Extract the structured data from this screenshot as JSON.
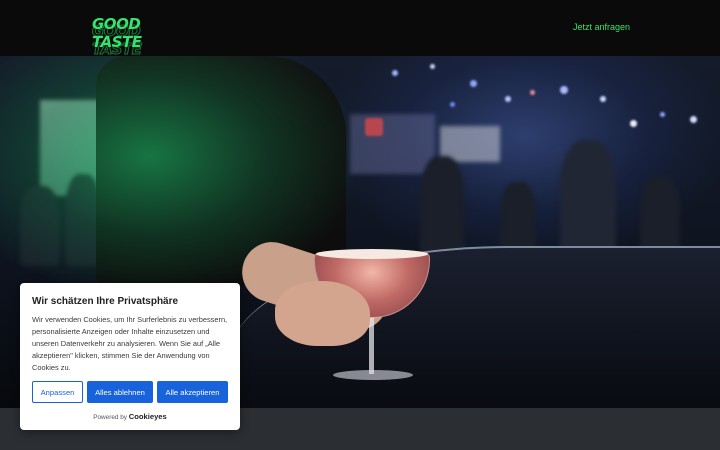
{
  "header": {
    "logo_text": "GOOD TASTE",
    "cta_label": "Jetzt anfragen"
  },
  "colors": {
    "brand_green": "#35e36e",
    "header_bg": "#0a0a0a",
    "button_blue": "#1863dc"
  },
  "cookie_banner": {
    "title": "Wir schätzen Ihre Privatsphäre",
    "body": "Wir verwenden Cookies, um Ihr Surferlebnis zu verbessern, personalisierte Anzeigen oder Inhalte einzusetzen und unseren Datenverkehr zu analysieren. Wenn Sie auf „Alle akzeptieren\" klicken, stimmen Sie der Anwendung von Cookies zu.",
    "customize_label": "Anpassen",
    "reject_label": "Alles ablehnen",
    "accept_label": "Alle akzeptieren",
    "powered_by_label": "Powered by",
    "powered_by_brand": "Cookieyes"
  }
}
